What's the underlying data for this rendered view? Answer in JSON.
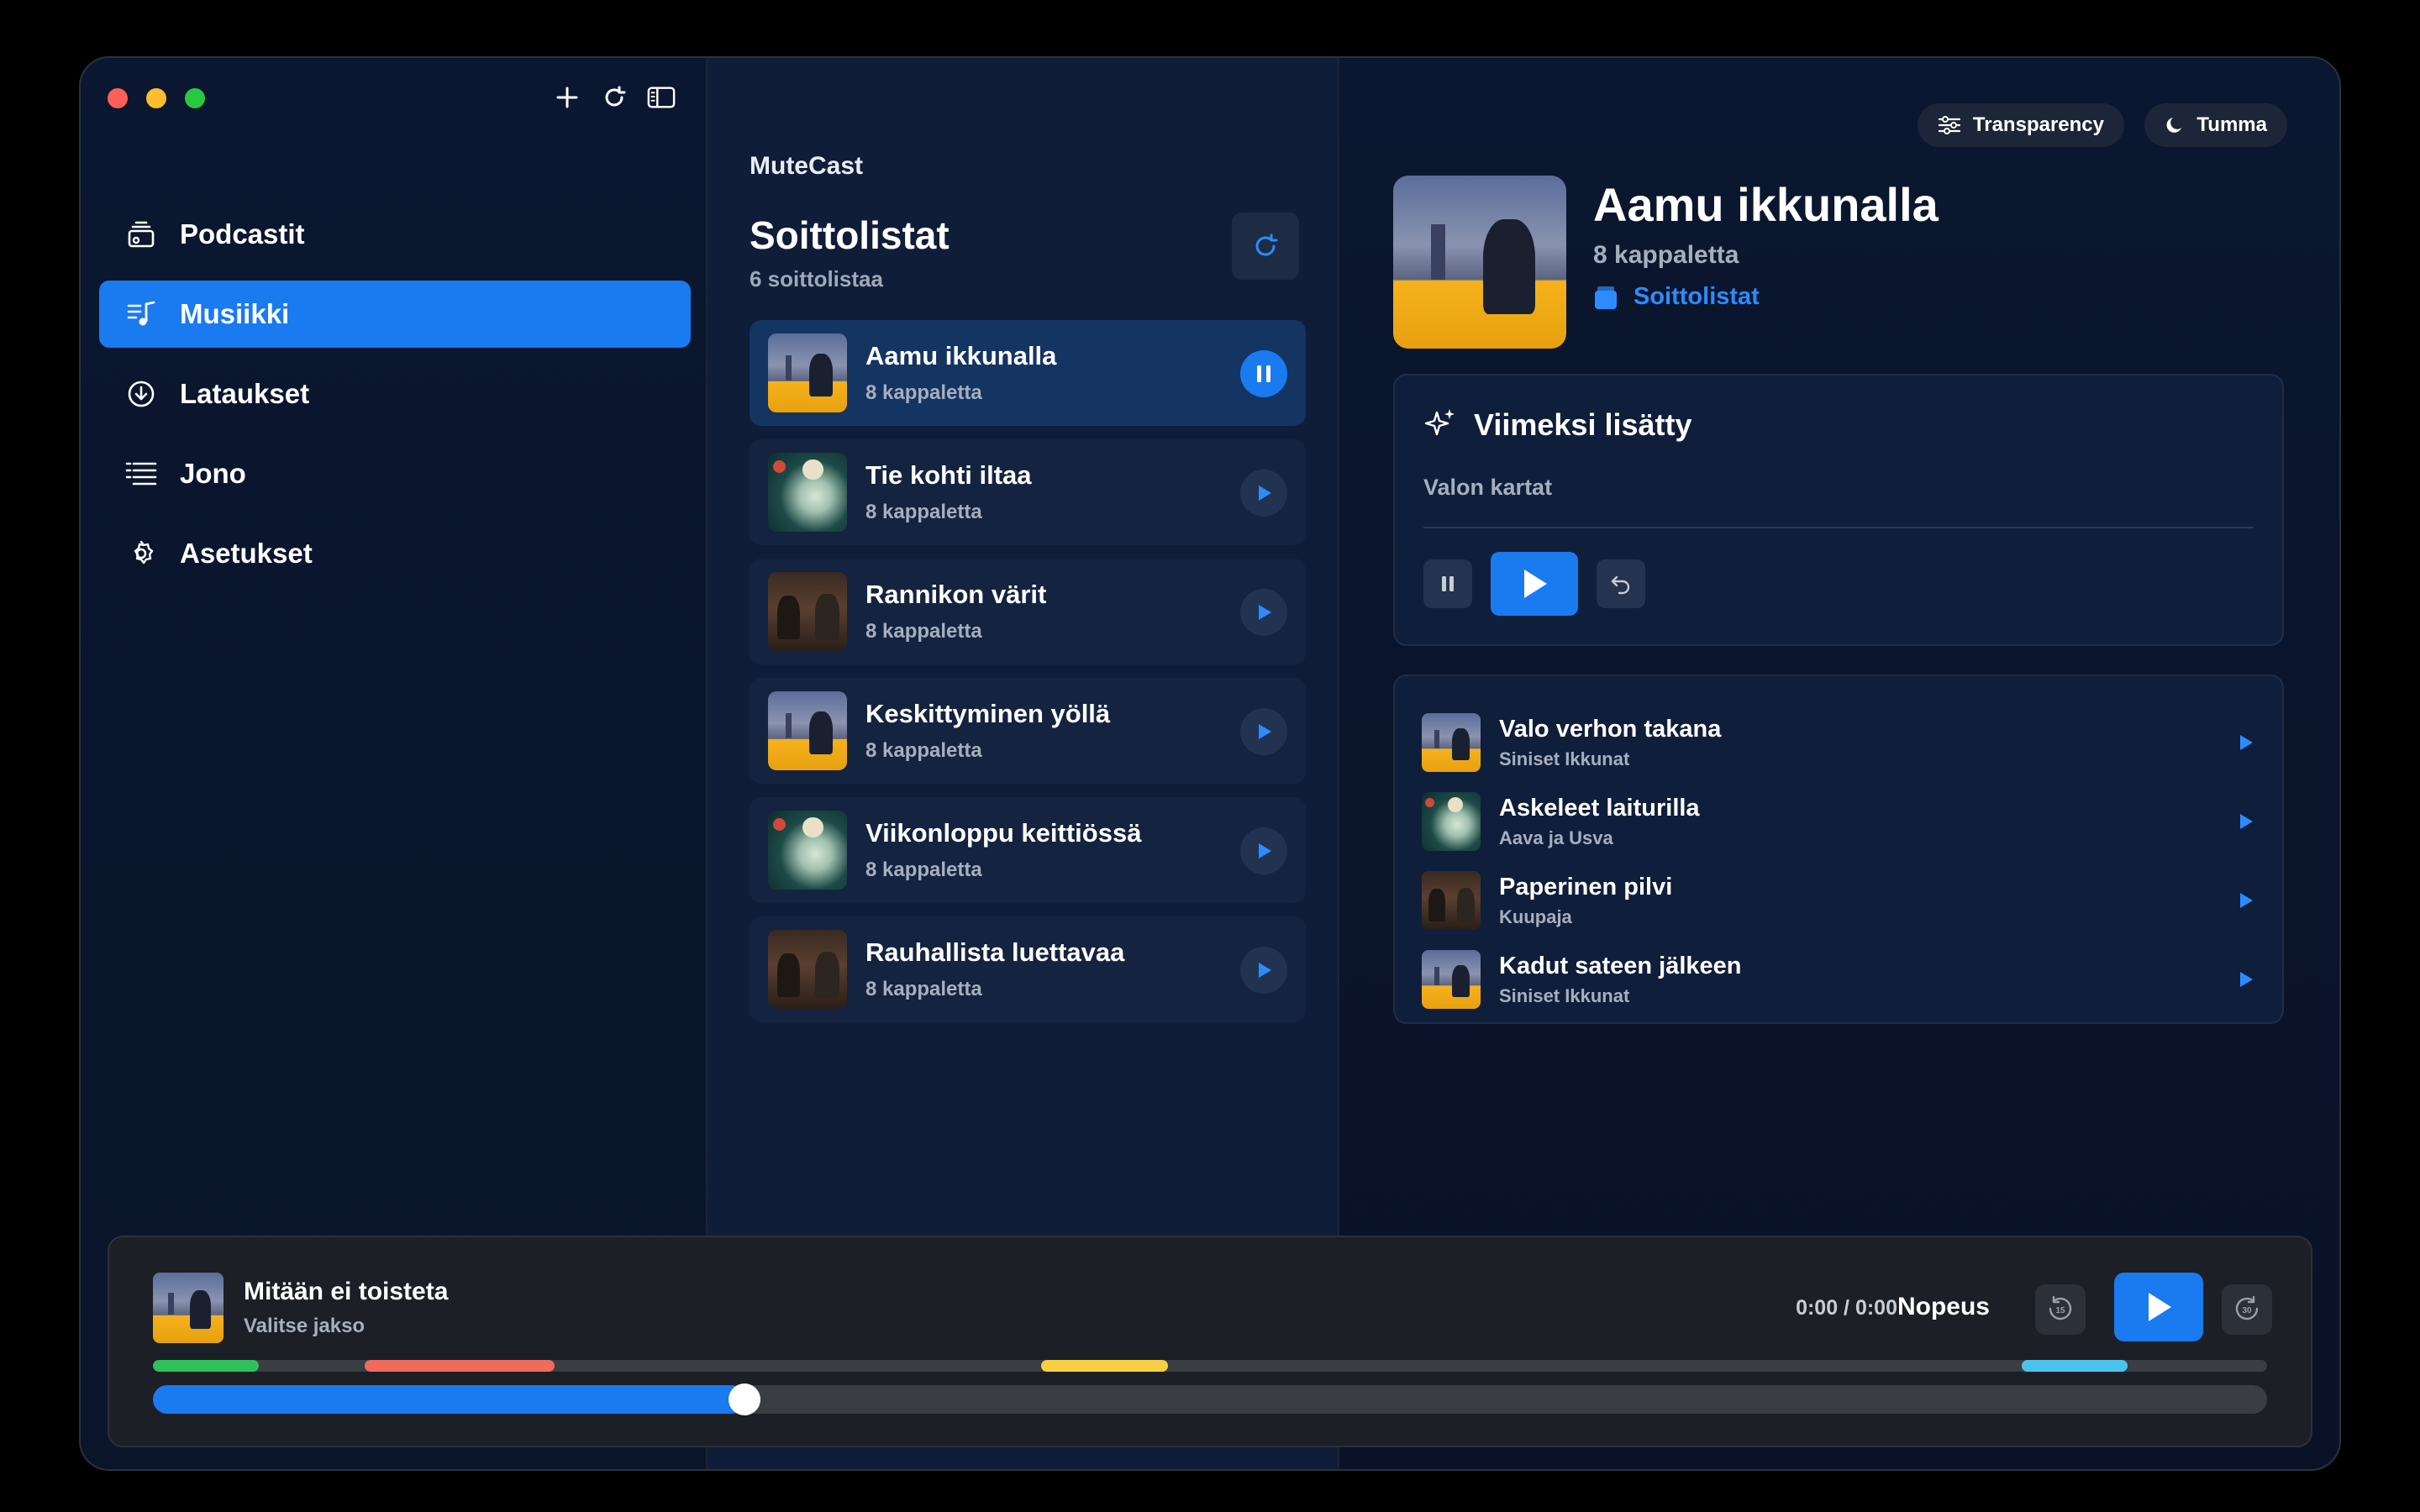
{
  "app": {
    "name": "MuteCast"
  },
  "sidebar": {
    "items": [
      {
        "label": "Podcastit",
        "icon": "podcast-icon",
        "active": false
      },
      {
        "label": "Musiikki",
        "icon": "music-icon",
        "active": true
      },
      {
        "label": "Lataukset",
        "icon": "download-icon",
        "active": false
      },
      {
        "label": "Jono",
        "icon": "queue-icon",
        "active": false
      },
      {
        "label": "Asetukset",
        "icon": "gear-icon",
        "active": false
      }
    ]
  },
  "playlists": {
    "title": "Soittolistat",
    "count": "6 soittolistaa",
    "items": [
      {
        "name": "Aamu ikkunalla",
        "sub": "8 kappaletta",
        "art": "city",
        "active": true
      },
      {
        "name": "Tie kohti iltaa",
        "sub": "8 kappaletta",
        "art": "plane",
        "active": false
      },
      {
        "name": "Rannikon värit",
        "sub": "8 kappaletta",
        "art": "cafe",
        "active": false
      },
      {
        "name": "Keskittyminen yöllä",
        "sub": "8 kappaletta",
        "art": "city",
        "active": false
      },
      {
        "name": "Viikonloppu keittiössä",
        "sub": "8 kappaletta",
        "art": "plane",
        "active": false
      },
      {
        "name": "Rauhallista luettavaa",
        "sub": "8 kappaletta",
        "art": "cafe",
        "active": false
      }
    ]
  },
  "detail": {
    "transparency_label": "Transparency",
    "theme_label": "Tumma",
    "title": "Aamu ikkunalla",
    "sub": "8 kappaletta",
    "link": "Soittolistat",
    "recent": {
      "title": "Viimeksi lisätty",
      "sub": "Valon kartat"
    },
    "tracks": [
      {
        "name": "Valo verhon takana",
        "artist": "Siniset Ikkunat",
        "art": "city"
      },
      {
        "name": "Askeleet laiturilla",
        "artist": "Aava ja Usva",
        "art": "plane"
      },
      {
        "name": "Paperinen pilvi",
        "artist": "Kuupaja",
        "art": "cafe"
      },
      {
        "name": "Kadut sateen jälkeen",
        "artist": "Siniset Ikkunat",
        "art": "city"
      }
    ]
  },
  "player": {
    "title": "Mitään ei toisteta",
    "sub": "Valitse jakso",
    "time": "0:00 / 0:00",
    "speed_label": "Nopeus",
    "skip_back": "15",
    "skip_forward": "30",
    "progress": 0.28,
    "chapters": [
      {
        "start": 0.0,
        "end": 0.05,
        "color": "#2fbf5b"
      },
      {
        "start": 0.1,
        "end": 0.19,
        "color": "#f06a5e"
      },
      {
        "start": 0.42,
        "end": 0.48,
        "color": "#f7cf45"
      },
      {
        "start": 0.884,
        "end": 0.934,
        "color": "#4cc3ec"
      }
    ]
  },
  "colors": {
    "accent": "#1a7af0",
    "background": "#0a1428"
  }
}
